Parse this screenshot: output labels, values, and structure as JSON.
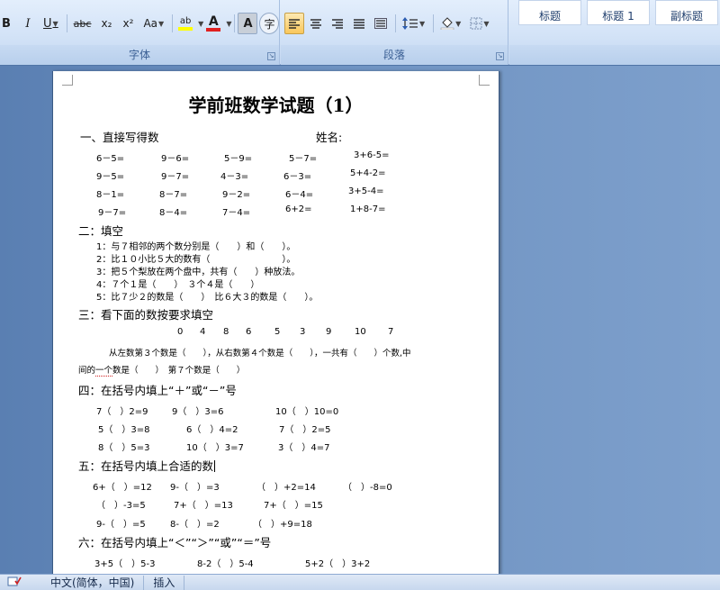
{
  "ribbon": {
    "font_group": {
      "label": "字体",
      "buttons": [
        "B",
        "I",
        "U",
        "abc",
        "x₂",
        "x²",
        "Aa",
        "ab",
        "A",
        "A",
        "字"
      ]
    },
    "paragraph_group": {
      "label": "段落"
    },
    "styles_group": {
      "items": [
        "标题",
        "标题 1",
        "副标题"
      ]
    }
  },
  "document": {
    "title": "学前班数学试题（1）",
    "section1": {
      "heading": "一、直接写得数",
      "name_label": "姓名:",
      "rows": [
        [
          "6－5=",
          "9－6=",
          "5－9=",
          "5－7=",
          "3+6-5="
        ],
        [
          "9－5=",
          "9－7=",
          "4－3=",
          "6－3=",
          "5+4-2="
        ],
        [
          "8－1=",
          "8－7=",
          "9－2=",
          "6－4=",
          "3+5-4="
        ],
        [
          "9－7=",
          "8－4=",
          "7－4=",
          "6+2=",
          "1+8-7="
        ]
      ]
    },
    "section2": {
      "heading": "二：填空",
      "lines": [
        "1：与７相邻的两个数分别是（　　）和（　　）。",
        "2：比１０小比５大的数有（　　　　　　　　）。",
        "3：把５个梨放在两个盘中，共有（　　）种放法。",
        "4：７个１是（　　）　３个４是（　　）",
        "5：比７少２的数是（　　）　比６大３的数是（　　）。"
      ]
    },
    "section3": {
      "heading": "三：看下面的数按要求填空",
      "numbers": [
        "0",
        "4",
        "8",
        "6",
        "5",
        "3",
        "9",
        "10",
        "7"
      ],
      "line1": "从左数第３个数是（　　），从右数第４个数是（　　），一共有（　　）个数,中",
      "line2_pre": "间的",
      "line2_squig": "一个",
      "line2_post": "数是（　　）　第７个数是（　　）"
    },
    "section4": {
      "heading": "四：在括号内填上“＋”或“－”号",
      "rows": [
        [
          "7（　）2=9",
          "9（　）3=6",
          "10（　）10=0"
        ],
        [
          "5（　）3=8",
          "6（　）4=2",
          "7（　）2=5"
        ],
        [
          "8（　）5=3",
          "10（　）3=7",
          "3（　）4=7"
        ]
      ]
    },
    "section5": {
      "heading": "五：在括号内填上合适的数",
      "rows": [
        [
          "6+（　）=12",
          "9-（　）=3",
          "（　）+2=14",
          "（　）-8=0"
        ],
        [
          "（　）-3=5",
          "7+（　）=13",
          "7+（　）=15"
        ],
        [
          "9-（　）=5",
          "8-（　）=2",
          "（　）+9=18"
        ]
      ]
    },
    "section6": {
      "heading": "六：在括号内填上“＜”“＞”“或”“＝”号",
      "rows": [
        [
          "3+5（　）5-3",
          "8-2（　）5-4",
          "5+2（　）3+2"
        ]
      ]
    }
  },
  "status_bar": {
    "language": "中文(简体，中国)",
    "mode": "插入"
  },
  "colors": {
    "ribbon_bg": "#d3e3f7",
    "doc_bg": "#5a7fb2",
    "page_bg": "#ffffff",
    "highlight": "#f9c75b",
    "font_color_bar": "#e02020",
    "highlight_bar": "#ffff00"
  }
}
